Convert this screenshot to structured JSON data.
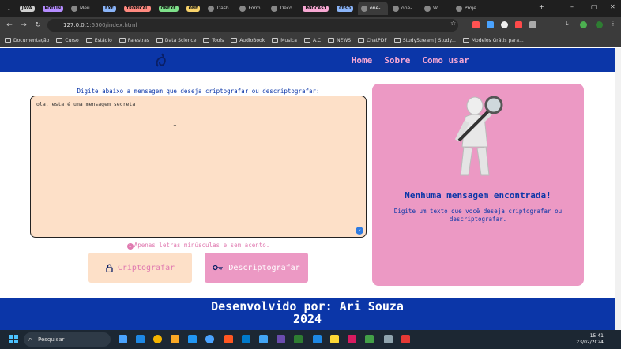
{
  "browser": {
    "tabs": [
      {
        "chip": "JAVA",
        "color": "#d0d0d0"
      },
      {
        "chip": "KOTLIN",
        "color": "#b58cff"
      },
      {
        "label": "Meu"
      },
      {
        "chip": "EXE",
        "color": "#8ab4f8"
      },
      {
        "chip": "TROPICAL",
        "color": "#ff8a80"
      },
      {
        "chip": "ONEXE",
        "color": "#7ee08a"
      },
      {
        "chip": "ONE",
        "color": "#f8d36a"
      },
      {
        "label": "Dash"
      },
      {
        "label": "Form"
      },
      {
        "label": "Deco"
      },
      {
        "chip": "PODCAST",
        "color": "#f7a8d3"
      },
      {
        "chip": "CESO",
        "color": "#8ab4f8"
      },
      {
        "label": "one-",
        "active": true
      },
      {
        "label": "one-"
      },
      {
        "label": "W"
      },
      {
        "label": "Proje"
      }
    ],
    "url_host": "127.0.0.1",
    "url_rest": ":5500/index.html",
    "bookmarks": [
      "Documentação",
      "Curso",
      "Estágio",
      "Palestras",
      "Data Science",
      "Tools",
      "AudioBook",
      "Musica",
      "A.C",
      "NEWS",
      "ChatPDF",
      "StudyStream | Study...",
      "Modelos Grátis para..."
    ]
  },
  "header": {
    "nav": [
      "Home",
      "Sobre",
      "Como usar"
    ]
  },
  "main": {
    "prompt": "Digite abaixo a mensagem que deseja criptografar ou descriptografar:",
    "textarea_value": "ola, esta é uma mensagem secreta",
    "warning": "Apenas letras minúsculas e sem acento.",
    "encrypt_label": "Criptografar",
    "decrypt_label": "Descriptografar"
  },
  "result": {
    "title": "Nenhuma mensagem encontrada!",
    "description": "Digite um texto que você deseja criptografar ou descriptografar."
  },
  "footer": {
    "line1": "Desenvolvido por: Ari Souza",
    "line2": "2024"
  },
  "taskbar": {
    "search": "Pesquisar",
    "time": "15:41",
    "date": "23/02/2024"
  }
}
